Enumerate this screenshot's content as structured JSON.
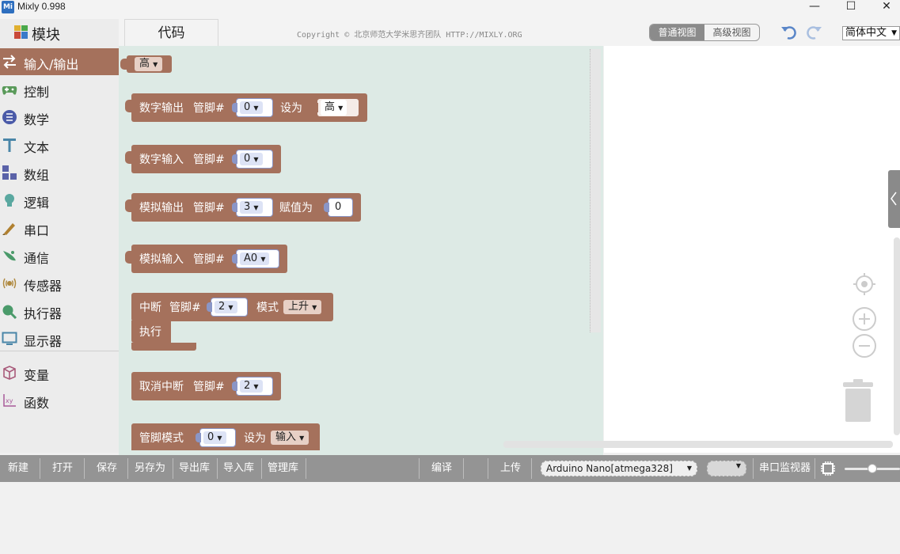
{
  "window": {
    "title": "Mixly 0.998",
    "icon_text": "Mi",
    "minimize": "—",
    "maximize": "☐",
    "close": "✕"
  },
  "header": {
    "blocks_label": "模块",
    "code_tab": "代码",
    "copyright": "Copyright © 北京师范大学米思齐团队 HTTP://MIXLY.ORG",
    "views": {
      "normal": "普通视图",
      "advanced": "高级视图",
      "active": "normal"
    },
    "language": "简体中文"
  },
  "sidebar": {
    "categories": [
      {
        "label": "输入/输出",
        "icon": "arrows-icon",
        "color": "#a5715c",
        "selected": true
      },
      {
        "label": "控制",
        "icon": "gamepad-icon",
        "color": "#5a9a5a"
      },
      {
        "label": "数学",
        "icon": "math-icon",
        "color": "#4a5aa8"
      },
      {
        "label": "文本",
        "icon": "text-icon",
        "color": "#4a86a8"
      },
      {
        "label": "数组",
        "icon": "array-icon",
        "color": "#5a62a8"
      },
      {
        "label": "逻辑",
        "icon": "bulb-icon",
        "color": "#5aa8a0"
      },
      {
        "label": "串口",
        "icon": "pen-icon",
        "color": "#b08030"
      },
      {
        "label": "通信",
        "icon": "satellite-icon",
        "color": "#4a9a6a"
      },
      {
        "label": "传感器",
        "icon": "sensor-icon",
        "color": "#b08a40"
      },
      {
        "label": "执行器",
        "icon": "actuator-icon",
        "color": "#4a9a6a"
      },
      {
        "label": "显示器",
        "icon": "monitor-icon",
        "color": "#4a86a8"
      },
      {
        "label": "变量",
        "icon": "variable-icon",
        "color": "#a85a7a"
      },
      {
        "label": "函数",
        "icon": "function-icon",
        "color": "#a85a9a"
      }
    ]
  },
  "blocks": {
    "level_dropdown": "高",
    "digital_write": {
      "label": "数字输出",
      "pin_label": "管脚#",
      "pin": "0",
      "set_label": "设为",
      "value": "高"
    },
    "digital_read": {
      "label": "数字输入",
      "pin_label": "管脚#",
      "pin": "0"
    },
    "analog_write": {
      "label": "模拟输出",
      "pin_label": "管脚#",
      "pin": "3",
      "assign_label": "赋值为",
      "value": "0"
    },
    "analog_read": {
      "label": "模拟输入",
      "pin_label": "管脚#",
      "pin": "A0"
    },
    "interrupt": {
      "label": "中断",
      "pin_label": "管脚#",
      "pin": "2",
      "mode_label": "模式",
      "mode": "上升",
      "do_label": "执行"
    },
    "detach_interrupt": {
      "label": "取消中断",
      "pin_label": "管脚#",
      "pin": "2"
    },
    "pin_mode": {
      "label": "管脚模式",
      "pin": "0",
      "set_label": "设为",
      "mode": "输入"
    }
  },
  "toolbar": {
    "new": "新建",
    "open": "打开",
    "save": "保存",
    "save_as": "另存为",
    "export_lib": "导出库",
    "import_lib": "导入库",
    "manage_lib": "管理库",
    "compile": "编译",
    "upload": "上传",
    "board": "Arduino Nano[atmega328]",
    "serial_monitor": "串口监视器"
  }
}
